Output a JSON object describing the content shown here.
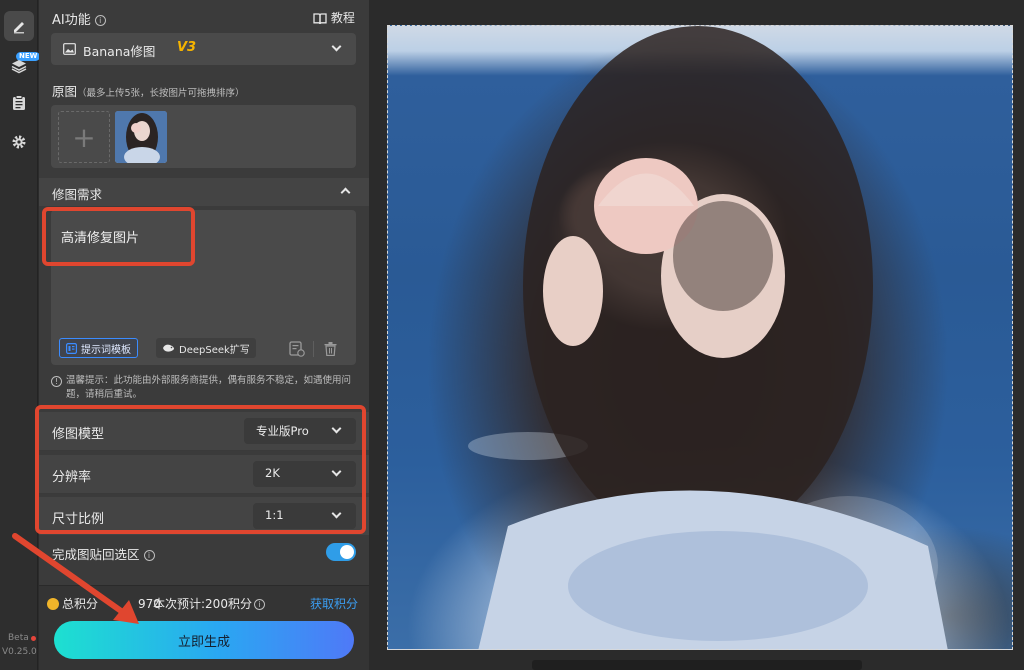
{
  "sidebar": {
    "new_badge": "NEW",
    "beta_label": "Beta",
    "version": "V0.25.0"
  },
  "panel": {
    "ai_title": "AI功能",
    "tutorial_label": "教程",
    "model_select": {
      "name": "Banana修图",
      "tag": "V3"
    },
    "source": {
      "label": "原图",
      "hint": "（最多上传5张，长按图片可拖拽排序）"
    },
    "requirements": {
      "title": "修图需求",
      "prompt_text": "高清修复图片",
      "template_button": "提示词模板",
      "deepseek_button": "DeepSeek扩写"
    },
    "notice": "温馨提示：此功能由外部服务商提供，偶有服务不稳定，如遇使用问题，请稍后重试。",
    "options": [
      {
        "label": "修图模型",
        "value": "专业版Pro"
      },
      {
        "label": "分辨率",
        "value": "2K"
      },
      {
        "label": "尺寸比例",
        "value": "1:1"
      }
    ],
    "paste_back": {
      "label": "完成图贴回选区",
      "enabled": true
    },
    "footer": {
      "total_points_label": "总积分",
      "total_points_value": "970",
      "estimate_label": "本次预计:200积分",
      "get_points_link": "获取积分",
      "generate_button": "立即生成"
    }
  },
  "colors": {
    "accent_blue": "#2f9de8",
    "highlight_red": "#e0462f",
    "button_gradient_start": "#1de0d0",
    "button_gradient_end": "#4f79f7"
  }
}
